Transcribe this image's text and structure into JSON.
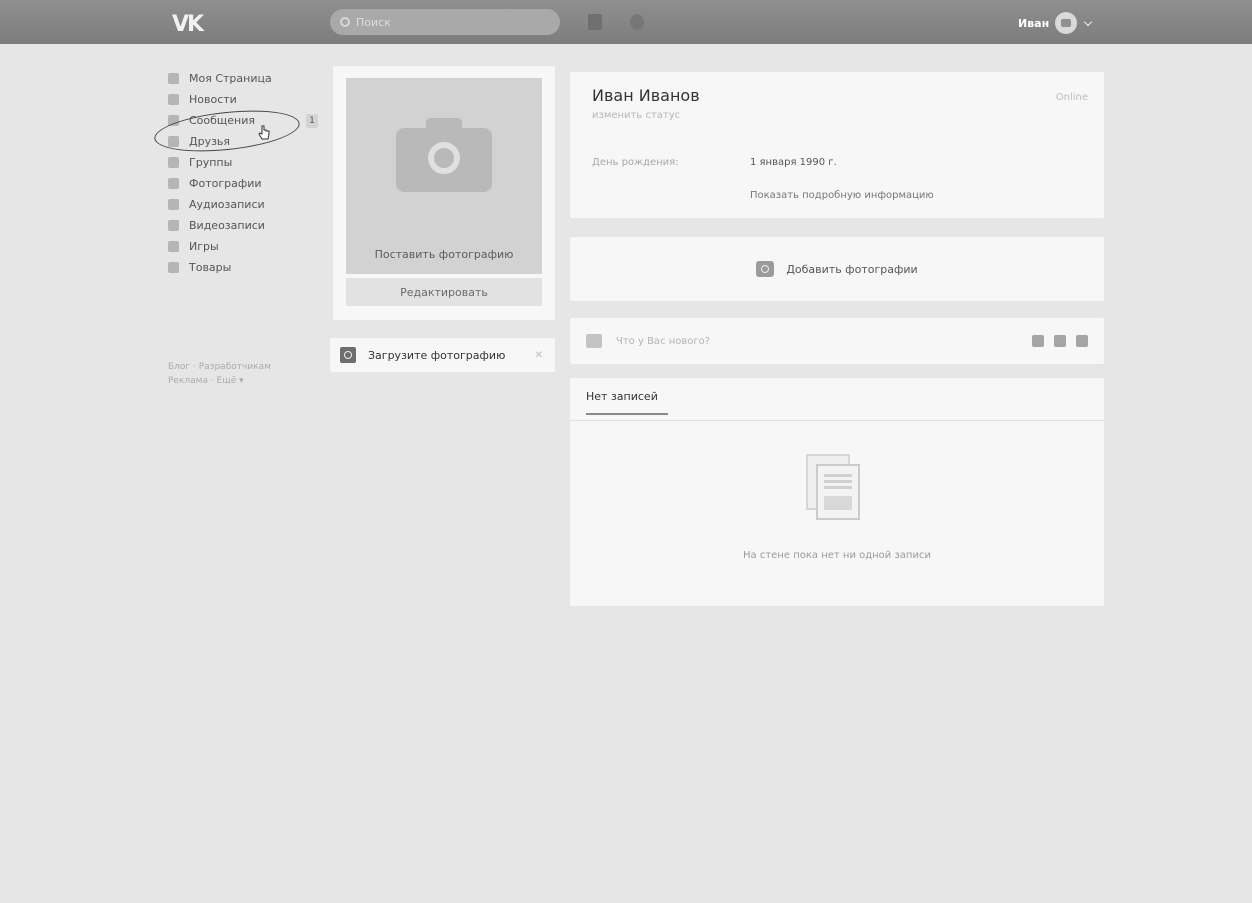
{
  "header": {
    "logo": "VK",
    "search_placeholder": "Поиск",
    "user_name": "Иван"
  },
  "nav": {
    "items": [
      {
        "label": "Моя Страница",
        "icon": "home-icon"
      },
      {
        "label": "Новости",
        "icon": "news-icon"
      },
      {
        "label": "Сообщения",
        "icon": "messages-icon",
        "badge": "1"
      },
      {
        "label": "Друзья",
        "icon": "friends-icon"
      },
      {
        "label": "Группы",
        "icon": "groups-icon"
      },
      {
        "label": "Фотографии",
        "icon": "photos-icon"
      },
      {
        "label": "Аудиозаписи",
        "icon": "audio-icon"
      },
      {
        "label": "Видеозаписи",
        "icon": "video-icon"
      },
      {
        "label": "Игры",
        "icon": "games-icon"
      },
      {
        "label": "Товары",
        "icon": "goods-icon"
      }
    ],
    "footer_line1": "Блог · Разработчикам",
    "footer_line2": "Реклама · Ещё ▾"
  },
  "photo_card": {
    "cta": "Поставить фотографию",
    "edit": "Редактировать"
  },
  "upload_notice": {
    "text": "Загрузите фотографию",
    "close": "✕"
  },
  "profile": {
    "name": "Иван Иванов",
    "status": "изменить статус",
    "online": "Online",
    "birthday_label": "День рождения:",
    "birthday_value": "1 января 1990 г.",
    "more_info": "Показать подробную информацию"
  },
  "add_photos": {
    "label": "Добавить фотографии"
  },
  "post_box": {
    "placeholder": "Что у Вас нового?"
  },
  "wall": {
    "tab": "Нет записей",
    "empty_text": "На стене пока нет ни одной записи"
  }
}
